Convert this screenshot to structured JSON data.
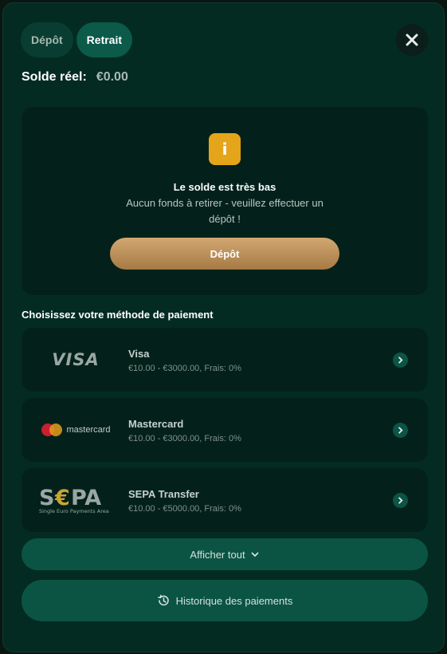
{
  "tabs": [
    {
      "label": "Dépôt",
      "active": false
    },
    {
      "label": "Retrait",
      "active": true
    }
  ],
  "close_icon": "close-icon",
  "balance": {
    "label": "Solde réel:",
    "value": "€0.00"
  },
  "alert": {
    "icon": "info-icon",
    "icon_glyph": "i",
    "title": "Le solde est très bas",
    "description": "Aucun fonds à retirer - veuillez effectuer un dépôt !",
    "button_label": "Dépôt"
  },
  "payment_section_title": "Choisissez votre méthode de paiement",
  "methods": [
    {
      "logo": "VISA",
      "name": "Visa",
      "info": "€10.00 - €3000.00, Frais: 0%"
    },
    {
      "logo": "mastercard",
      "name": "Mastercard",
      "info": "€10.00 - €3000.00, Frais: 0%"
    },
    {
      "logo": "SEPA",
      "logo_subtitle": "Single Euro Payments Area",
      "name": "SEPA Transfer",
      "info": "€10.00 - €5000.00, Frais: 0%"
    }
  ],
  "show_all_label": "Afficher tout",
  "history_label": "Historique des paiements",
  "colors": {
    "background": "#042b22",
    "card": "#03211a",
    "accent_gold": "#c69a62",
    "warning": "#e5a51a",
    "button": "#0b5444"
  }
}
